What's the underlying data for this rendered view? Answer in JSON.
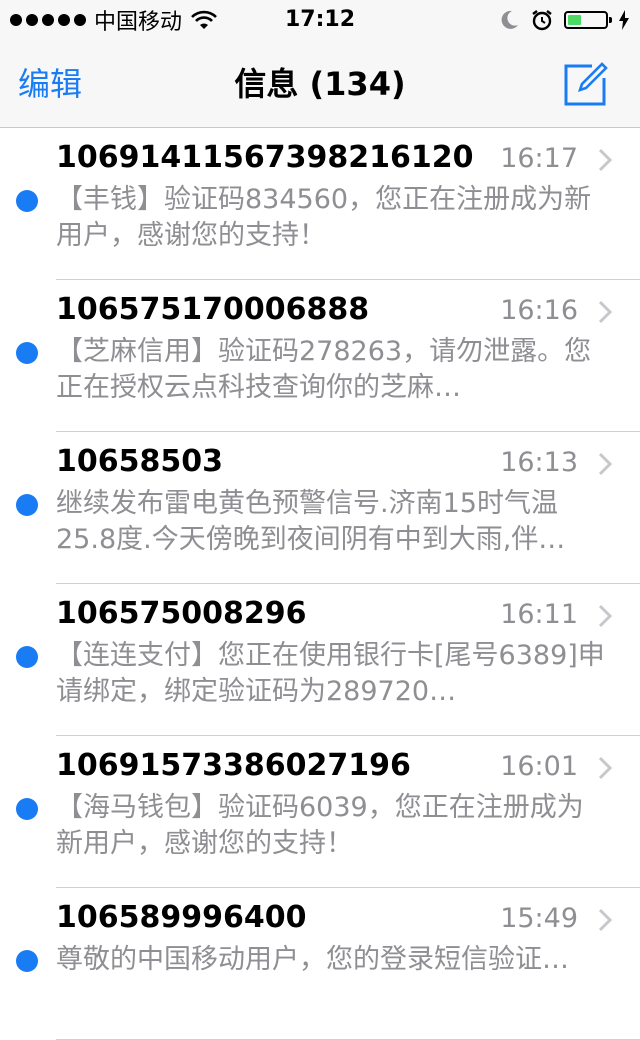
{
  "status_bar": {
    "carrier": "中国移动",
    "time": "17:12",
    "battery_level": 0.35
  },
  "nav": {
    "edit_label": "编辑",
    "title": "信息 (134)"
  },
  "messages": [
    {
      "sender": "106914115673982161​20",
      "time": "16:17",
      "preview": "【丰钱】验证码834560，您正在注册成为新用户，感谢您的支持！"
    },
    {
      "sender": "1065751700068​88",
      "time": "16:16",
      "preview": "【芝麻信用】验证码278263，请勿泄露。您正在授权云点科技查询你的芝麻…"
    },
    {
      "sender": "10658503",
      "time": "16:13",
      "preview": "继续发布雷电黄色预警信号.济南15时气温25.8度.今天傍晚到夜间阴有中到大雨,伴…"
    },
    {
      "sender": "106575008296",
      "time": "16:11",
      "preview": "【连连支付】您正在使用银行卡[尾号6389]申请绑定，绑定验证码为289720…"
    },
    {
      "sender": "10691573386027196",
      "time": "16:01",
      "preview": "【海马钱包】验证码6039，您正在注册成为新用户，感谢您的支持！"
    },
    {
      "sender": "106589996400",
      "time": "15:49",
      "preview": "尊敬的中国移动用户，您的登录短信验证…"
    }
  ],
  "colors": {
    "accent": "#1a7cf4",
    "unread_dot": "#1a7cf4",
    "battery": "#4cd964"
  }
}
